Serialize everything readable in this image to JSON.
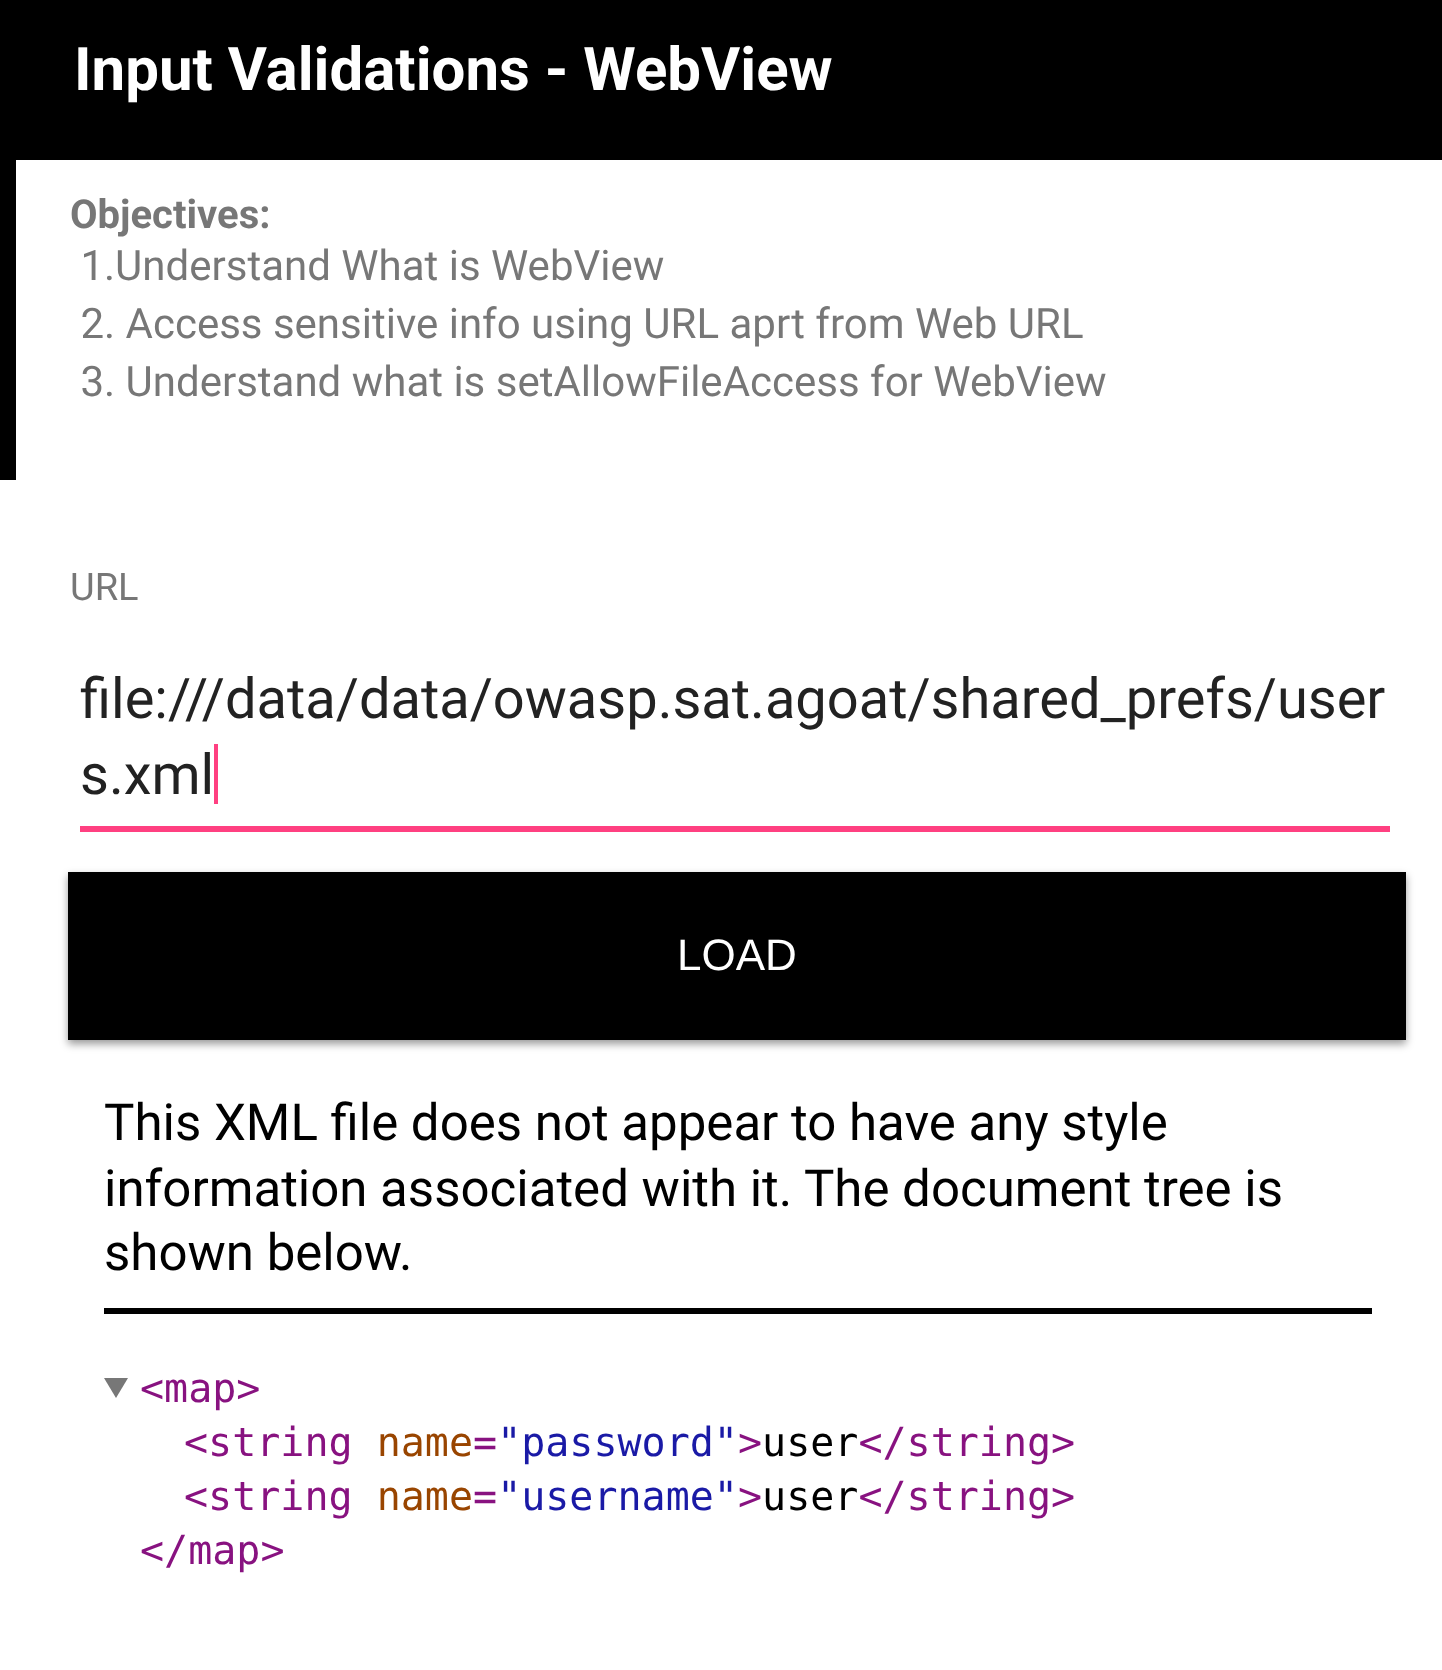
{
  "app_bar": {
    "title": "Input Validations - WebView"
  },
  "objectives": {
    "heading": "Objectives:",
    "items": [
      " 1.Understand What is WebView",
      " 2. Access sensitive info using URL aprt from Web URL",
      " 3. Understand what is setAllowFileAccess for WebView"
    ]
  },
  "url_field": {
    "label": "URL",
    "value": "file:///data/data/owasp.sat.agoat/shared_prefs/users.xml",
    "focused": true
  },
  "load_button": {
    "label": "LOAD"
  },
  "webview": {
    "notice": "This XML file does not appear to have any style information associated with it. The document tree is shown below.",
    "xml_tree": {
      "expanded": true,
      "open": [
        {
          "kind": "tag",
          "text": "<map>"
        }
      ],
      "children": [
        {
          "tokens": [
            {
              "kind": "tag",
              "text": "<string"
            },
            {
              "kind": "attr",
              "text": " name"
            },
            {
              "kind": "tag",
              "text": "="
            },
            {
              "kind": "value",
              "text": "\"password\""
            },
            {
              "kind": "tag",
              "text": ">"
            },
            {
              "kind": "text",
              "text": "user"
            },
            {
              "kind": "tag",
              "text": "</string>"
            }
          ]
        },
        {
          "tokens": [
            {
              "kind": "tag",
              "text": "<string"
            },
            {
              "kind": "attr",
              "text": " name"
            },
            {
              "kind": "tag",
              "text": "="
            },
            {
              "kind": "value",
              "text": "\"username\""
            },
            {
              "kind": "tag",
              "text": ">"
            },
            {
              "kind": "text",
              "text": "user"
            },
            {
              "kind": "tag",
              "text": "</string>"
            }
          ]
        }
      ],
      "close": [
        {
          "kind": "tag",
          "text": "</map>"
        }
      ]
    }
  }
}
